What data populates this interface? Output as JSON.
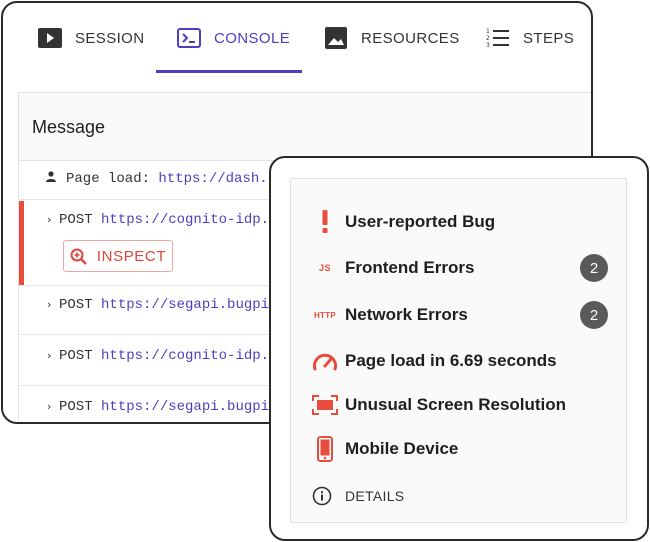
{
  "tabs": [
    {
      "label": "SESSION",
      "icon": "play-icon"
    },
    {
      "label": "CONSOLE",
      "icon": "terminal-icon"
    },
    {
      "label": "RESOURCES",
      "icon": "image-icon"
    },
    {
      "label": "STEPS",
      "icon": "numbered-list-icon"
    }
  ],
  "active_tab": "CONSOLE",
  "colors": {
    "accent": "#4b3fc0",
    "error": "#e74c3c",
    "badge": "#5a5a5a"
  },
  "console": {
    "header": "Message",
    "rows": [
      {
        "method": "Page load:",
        "url": "https://dash."
      },
      {
        "method": "POST",
        "url": "https://cognito-idp."
      },
      {
        "method": "POST",
        "url": "https://segapi.bugpi"
      },
      {
        "method": "POST",
        "url": "https://cognito-idp."
      },
      {
        "method": "POST",
        "url": "https://segapi.bugpi"
      }
    ],
    "inspect_label": "INSPECT"
  },
  "summary": {
    "items": [
      {
        "label": "User-reported Bug",
        "icon": "exclamation-icon"
      },
      {
        "label": "Frontend Errors",
        "icon": "js-icon",
        "icon_text": "JS",
        "count": "2"
      },
      {
        "label": "Network Errors",
        "icon": "http-icon",
        "icon_text": "HTTP",
        "count": "2"
      },
      {
        "label": "Page load in 6.69 seconds",
        "icon": "speedometer-icon"
      },
      {
        "label": "Unusual Screen Resolution",
        "icon": "screen-resolution-icon"
      },
      {
        "label": "Mobile Device",
        "icon": "mobile-device-icon"
      }
    ],
    "details_label": "DETAILS"
  }
}
